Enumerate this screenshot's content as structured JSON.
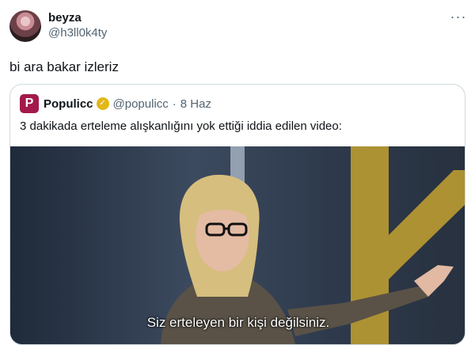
{
  "tweet": {
    "author_name": "beyza",
    "author_handle": "@h3ll0k4ty",
    "text": "bi ara bakar izleriz",
    "more_icon": "more-horizontal-icon"
  },
  "quoted": {
    "logo_letter": "P",
    "author_name": "Populicc",
    "author_handle": "@populicc",
    "separator": "·",
    "date": "8 Haz",
    "text": "3 dakikada erteleme alışkanlığını yok ettiği iddia edilen video:",
    "verified_icon": "verified-badge-icon",
    "brand_color": "#a3194c",
    "badge_color": "#e2b719"
  },
  "media": {
    "subtitle": "Siz erteleyen bir kişi değilsiniz."
  }
}
